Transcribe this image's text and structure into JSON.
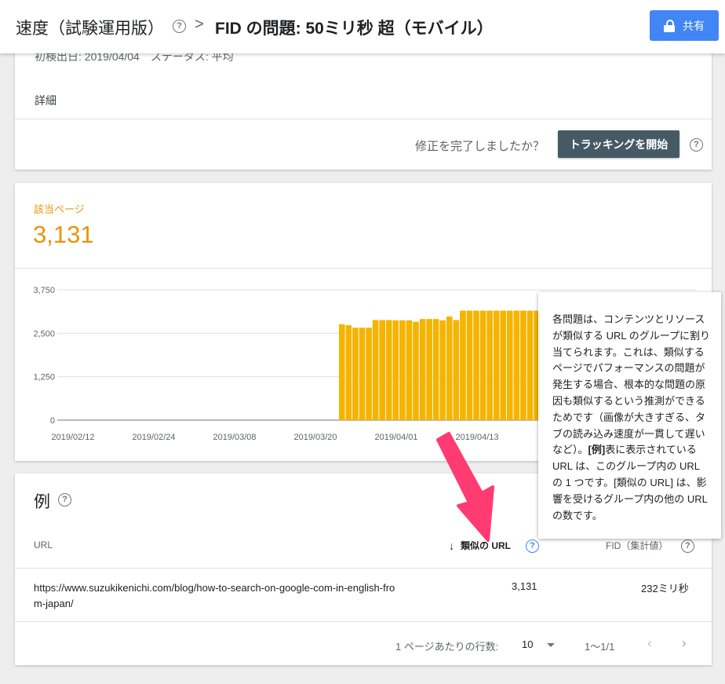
{
  "header": {
    "crumb1": "速度（試験運用版）",
    "crumb2": "FID の問題: 50ミリ秒 超（モバイル）",
    "share_label": "共有"
  },
  "issue_card": {
    "cut_text": "初検出日: 2019/04/04　ステータス: 平均",
    "details_label": "詳細",
    "fix_question": "修正を完了しましたか？",
    "tracking_button": "トラッキングを開始"
  },
  "affected": {
    "label": "該当ページ",
    "count": "3,131"
  },
  "chart_data": {
    "type": "bar",
    "y_ticks": [
      "3,750",
      "2,500",
      "1,250",
      "0"
    ],
    "ylim": [
      0,
      3750
    ],
    "x_ticks": [
      "2019/02/12",
      "2019/02/24",
      "2019/03/08",
      "2019/03/20",
      "2019/04/01",
      "2019/04/13"
    ],
    "bar_color": "#f4b400",
    "grid": true,
    "values": [
      2760,
      2730,
      2660,
      2660,
      2660,
      2880,
      2880,
      2880,
      2870,
      2870,
      2870,
      2830,
      2910,
      2910,
      2910,
      2870,
      2980,
      2880,
      3150,
      3150,
      3150,
      3150,
      3150,
      3150,
      3150,
      3150,
      3150,
      3150,
      3150,
      3150,
      3150,
      3150,
      3150,
      3150,
      3150,
      3150,
      3150
    ]
  },
  "examples": {
    "title": "例",
    "col_url": "URL",
    "col_similar": "類似の URL",
    "col_fid": "FID（集計値）",
    "rows": [
      {
        "url": "https://www.suzukikenichi.com/blog/how-to-search-on-google-com-in-english-from-japan/",
        "similar": "3,131",
        "fid": "232ミリ秒"
      }
    ],
    "rows_per_page_label": "1 ページあたりの行数:",
    "rows_per_page": "10",
    "range": "1〜1/1"
  },
  "tooltip": {
    "text1": "各問題は、コンテンツとリソースが類似する URL のグループに割り当てられます。これは、類似するページでパフォーマンスの問題が発生する場合、根本的な問題の原因も類似するという推測ができるためです（画像が大きすぎる、タブの読み込み速度が一貫して遅いなど）。",
    "bold1": "[例]",
    "text2": "表に表示されている URL は、このグループ内の URL の 1 つです。[類似の URL] は、影響を受けるグループ内の他の URL の数です。"
  },
  "colors": {
    "accent_orange": "#e8940a",
    "bar": "#f4b400",
    "share_blue": "#4285f4",
    "track_button": "#455a64",
    "annotation_arrow": "#ff3b72"
  }
}
